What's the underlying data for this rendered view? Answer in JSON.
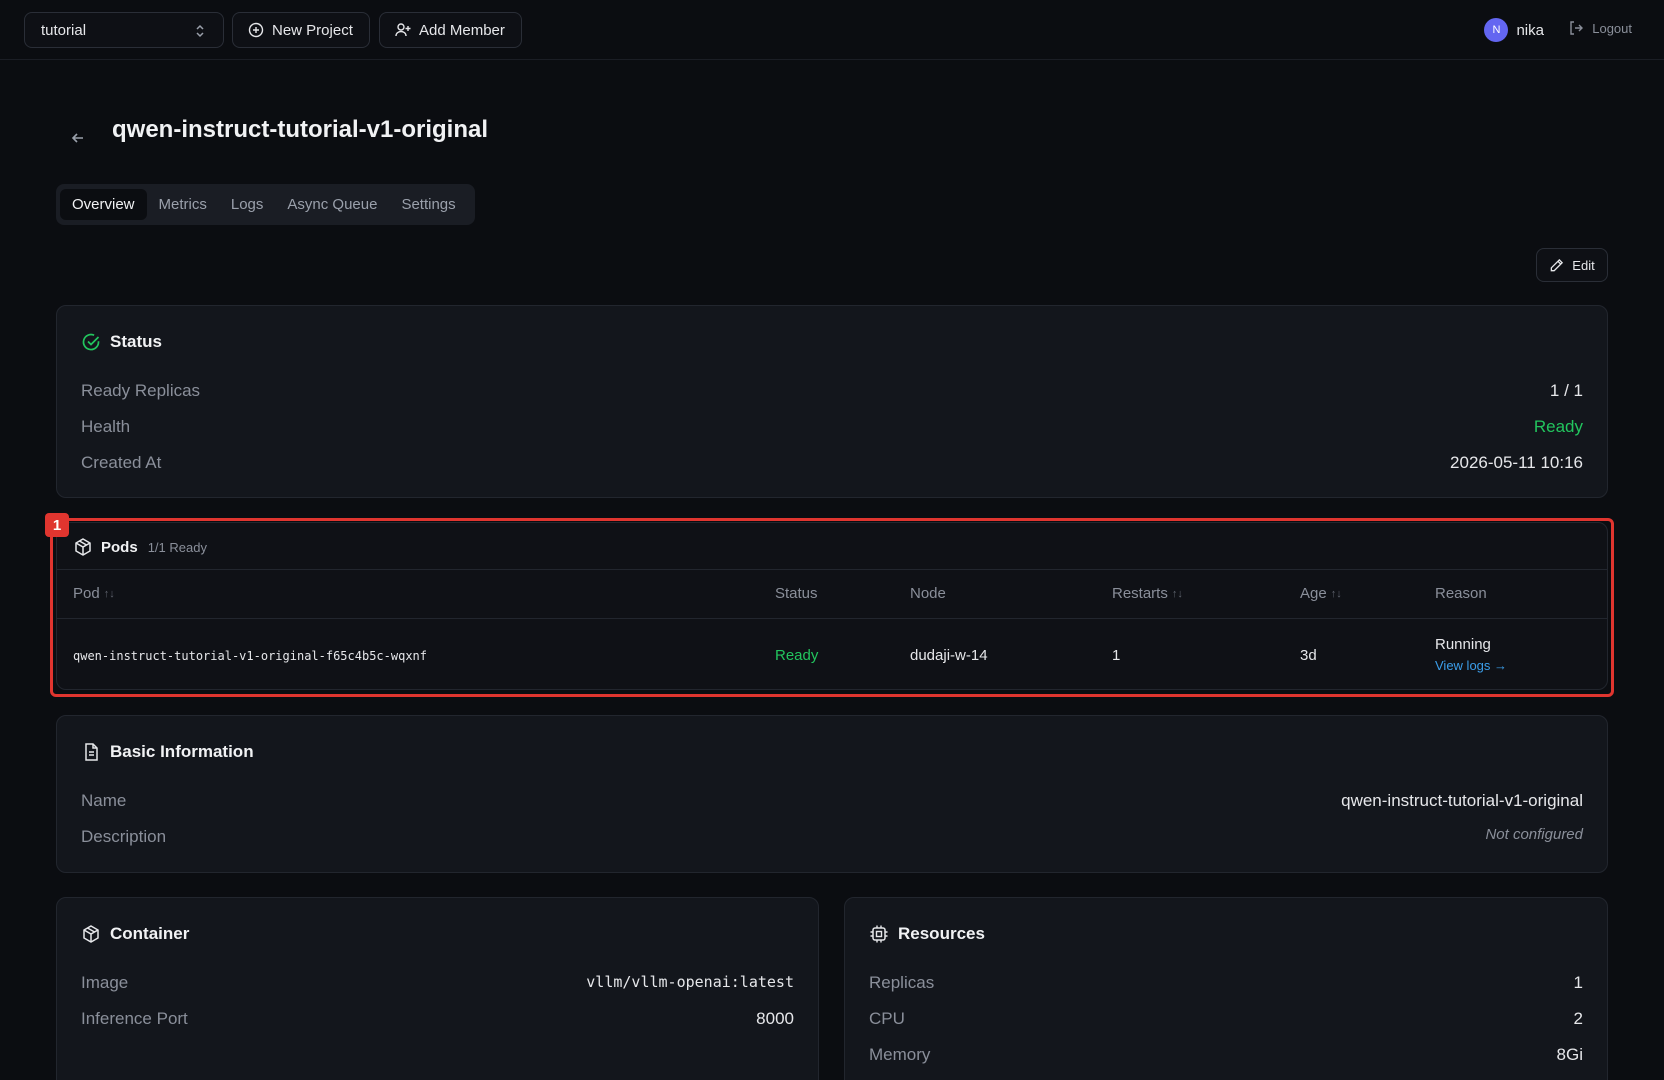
{
  "topbar": {
    "project": "tutorial",
    "new_project": "New Project",
    "add_member": "Add Member",
    "avatar_initial": "N",
    "username": "nika",
    "logout": "Logout"
  },
  "page": {
    "title": "qwen-instruct-tutorial-v1-original",
    "tabs": [
      "Overview",
      "Metrics",
      "Logs",
      "Async Queue",
      "Settings"
    ],
    "active_tab": "Overview",
    "edit": "Edit"
  },
  "status": {
    "title": "Status",
    "rows": [
      {
        "label": "Ready Replicas",
        "value": "1 / 1"
      },
      {
        "label": "Health",
        "value": "Ready"
      },
      {
        "label": "Created At",
        "value": "2026-05-11 10:16"
      }
    ]
  },
  "highlight": {
    "number": "1"
  },
  "pods": {
    "title": "Pods",
    "subtitle": "1/1 Ready",
    "columns": [
      "Pod",
      "Status",
      "Node",
      "Restarts",
      "Age",
      "Reason"
    ],
    "rows": [
      {
        "pod": "qwen-instruct-tutorial-v1-original-f65c4b5c-wqxnf",
        "status": "Ready",
        "node": "dudaji-w-14",
        "restarts": "1",
        "age": "3d",
        "reason": "Running",
        "view_logs": "View logs →"
      }
    ]
  },
  "basic": {
    "title": "Basic Information",
    "rows": [
      {
        "label": "Name",
        "value": "qwen-instruct-tutorial-v1-original"
      },
      {
        "label": "Description",
        "value": "Not configured"
      }
    ]
  },
  "container": {
    "title": "Container",
    "rows": [
      {
        "label": "Image",
        "value": "vllm/vllm-openai:latest"
      },
      {
        "label": "Inference Port",
        "value": "8000"
      }
    ]
  },
  "resources": {
    "title": "Resources",
    "rows": [
      {
        "label": "Replicas",
        "value": "1"
      },
      {
        "label": "CPU",
        "value": "2"
      },
      {
        "label": "Memory",
        "value": "8Gi"
      }
    ]
  },
  "colors": {
    "accent_green": "#22c55e",
    "link_blue": "#3b9eea",
    "highlight_red": "#e0352f",
    "avatar": "#6366f1"
  }
}
